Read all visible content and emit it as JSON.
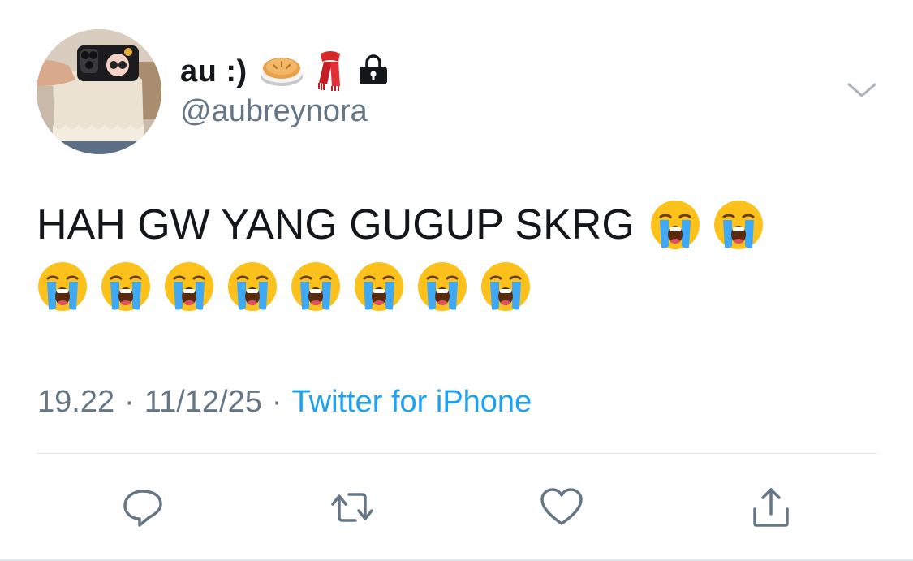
{
  "author": {
    "display_name": "au :)",
    "name_emojis": [
      "pie-emoji",
      "scarf-emoji"
    ],
    "protected_icon": "lock-icon",
    "handle": "@aubreynora"
  },
  "tweet": {
    "text": "HAH GW YANG GUGUP SKRG",
    "emoji": "loudly-crying-face-emoji",
    "emoji_count_line1": 2,
    "emoji_count_line2": 8
  },
  "meta": {
    "time": "19.22",
    "separator": "·",
    "date": "11/12/25",
    "source": "Twitter for iPhone"
  },
  "actions": [
    "reply-icon",
    "retweet-icon",
    "like-icon",
    "share-icon"
  ],
  "colors": {
    "text": "#14171a",
    "secondary": "#657786",
    "link": "#1da1f2",
    "divider": "#e1e8ed"
  }
}
